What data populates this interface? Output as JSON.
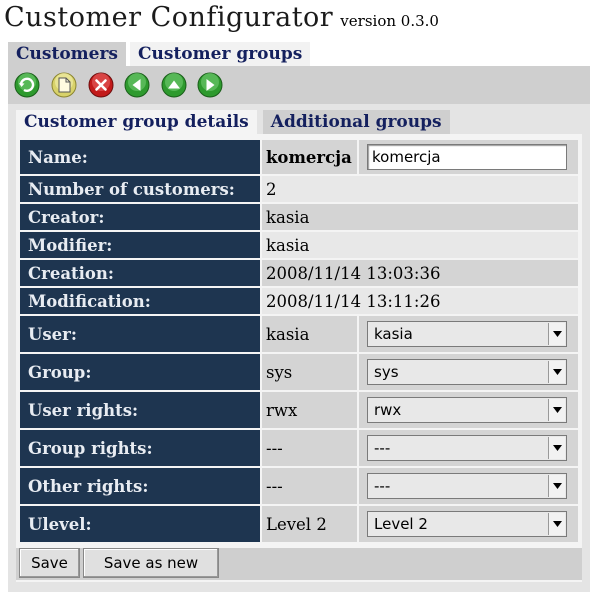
{
  "app": {
    "title": "Customer Configurator",
    "version": "version 0.3.0"
  },
  "top_tabs": [
    {
      "label": "Customers",
      "active": true
    },
    {
      "label": "Customer groups",
      "active": false
    }
  ],
  "toolbar": {
    "buttons": [
      {
        "name": "refresh-icon",
        "color": "#2e9a2e"
      },
      {
        "name": "new-document-icon",
        "color": "#d8d26a"
      },
      {
        "name": "delete-icon",
        "color": "#c21a1a"
      },
      {
        "name": "arrow-left-icon",
        "color": "#2e9a2e"
      },
      {
        "name": "arrow-up-icon",
        "color": "#2e9a2e"
      },
      {
        "name": "arrow-right-icon",
        "color": "#2e9a2e"
      }
    ]
  },
  "sub_tabs": [
    {
      "label": "Customer group details",
      "active": true
    },
    {
      "label": "Additional groups",
      "active": false
    }
  ],
  "fields": {
    "name": {
      "label": "Name:",
      "value": "komercja",
      "input_value": "komercja"
    },
    "num_customers": {
      "label": "Number of customers:",
      "value": "2"
    },
    "creator": {
      "label": "Creator:",
      "value": "kasia"
    },
    "modifier": {
      "label": "Modifier:",
      "value": "kasia"
    },
    "creation": {
      "label": "Creation:",
      "value": "2008/11/14 13:03:36"
    },
    "modification": {
      "label": "Modification:",
      "value": "2008/11/14 13:11:26"
    },
    "user": {
      "label": "User:",
      "value": "kasia",
      "selected": "kasia"
    },
    "group": {
      "label": "Group:",
      "value": "sys",
      "selected": "sys"
    },
    "user_rights": {
      "label": "User rights:",
      "value": "rwx",
      "selected": "rwx"
    },
    "group_rights": {
      "label": "Group rights:",
      "value": "---",
      "selected": "---"
    },
    "other_rights": {
      "label": "Other rights:",
      "value": "---",
      "selected": "---"
    },
    "ulevel": {
      "label": "Ulevel:",
      "value": "Level 2",
      "selected": "Level 2"
    }
  },
  "buttons": {
    "save": "Save",
    "save_as_new": "Save as new"
  },
  "colors": {
    "label_bg": "#1e3550",
    "title_tab": "#14205e"
  }
}
